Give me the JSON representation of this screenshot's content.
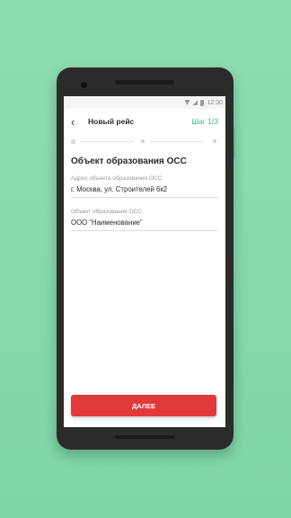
{
  "status_bar": {
    "time": "12:30"
  },
  "app_bar": {
    "title": "Новый рейс",
    "step": "Шаг 1/3"
  },
  "form": {
    "section_title": "Объект образования ОСС",
    "fields": [
      {
        "label": "Адрес объекта образования ОСС",
        "value": "г. Москва, ул. Строителей 6к2"
      },
      {
        "label": "Объект образования ОСС",
        "value": "ООО “Наименование”"
      }
    ]
  },
  "next_button": {
    "label": "ДАЛЕЕ"
  },
  "colors": {
    "accent": "#39b67a",
    "button": "#e23a3a",
    "background": "#8fdcb0"
  }
}
